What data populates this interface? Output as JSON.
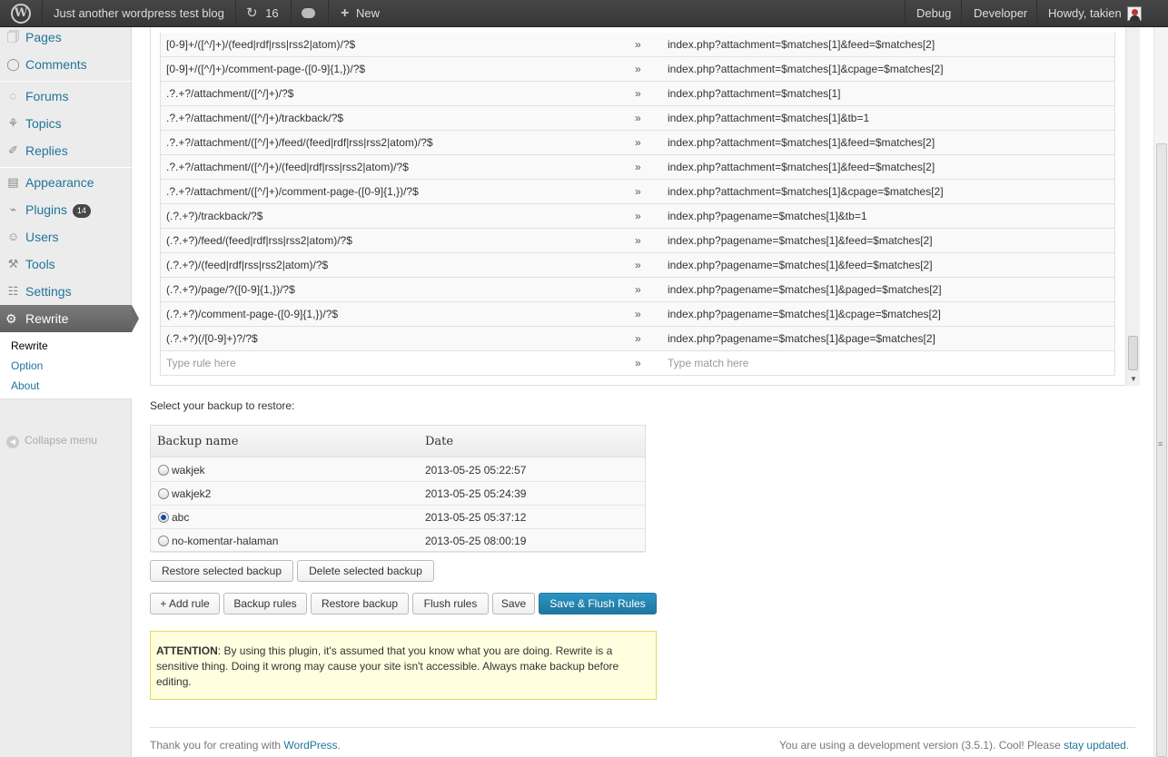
{
  "adminbar": {
    "site_name": "Just another wordpress test blog",
    "updates_count": "16",
    "new_label": "New",
    "debug_label": "Debug",
    "developer_label": "Developer",
    "greeting": "Howdy, takien"
  },
  "sidebar": {
    "items": [
      {
        "label": "Pages"
      },
      {
        "label": "Comments"
      },
      {
        "label": "Forums"
      },
      {
        "label": "Topics"
      },
      {
        "label": "Replies"
      },
      {
        "label": "Appearance"
      },
      {
        "label": "Plugins",
        "badge": "14"
      },
      {
        "label": "Users"
      },
      {
        "label": "Tools"
      },
      {
        "label": "Settings"
      },
      {
        "label": "Rewrite"
      }
    ],
    "submenu": [
      "Rewrite",
      "Option",
      "About"
    ],
    "collapse_label": "Collapse menu"
  },
  "rules": [
    {
      "pattern": "[0-9]+/([^/]+)/(feed|rdf|rss|rss2|atom)/?$",
      "match": "index.php?attachment=$matches[1]&feed=$matches[2]"
    },
    {
      "pattern": "[0-9]+/([^/]+)/comment-page-([0-9]{1,})/?$",
      "match": "index.php?attachment=$matches[1]&cpage=$matches[2]"
    },
    {
      "pattern": ".?.+?/attachment/([^/]+)/?$",
      "match": "index.php?attachment=$matches[1]"
    },
    {
      "pattern": ".?.+?/attachment/([^/]+)/trackback/?$",
      "match": "index.php?attachment=$matches[1]&tb=1"
    },
    {
      "pattern": ".?.+?/attachment/([^/]+)/feed/(feed|rdf|rss|rss2|atom)/?$",
      "match": "index.php?attachment=$matches[1]&feed=$matches[2]"
    },
    {
      "pattern": ".?.+?/attachment/([^/]+)/(feed|rdf|rss|rss2|atom)/?$",
      "match": "index.php?attachment=$matches[1]&feed=$matches[2]"
    },
    {
      "pattern": ".?.+?/attachment/([^/]+)/comment-page-([0-9]{1,})/?$",
      "match": "index.php?attachment=$matches[1]&cpage=$matches[2]"
    },
    {
      "pattern": "(.?.+?)/trackback/?$",
      "match": "index.php?pagename=$matches[1]&tb=1"
    },
    {
      "pattern": "(.?.+?)/feed/(feed|rdf|rss|rss2|atom)/?$",
      "match": "index.php?pagename=$matches[1]&feed=$matches[2]"
    },
    {
      "pattern": "(.?.+?)/(feed|rdf|rss|rss2|atom)/?$",
      "match": "index.php?pagename=$matches[1]&feed=$matches[2]"
    },
    {
      "pattern": "(.?.+?)/page/?([0-9]{1,})/?$",
      "match": "index.php?pagename=$matches[1]&paged=$matches[2]"
    },
    {
      "pattern": "(.?.+?)/comment-page-([0-9]{1,})/?$",
      "match": "index.php?pagename=$matches[1]&cpage=$matches[2]"
    },
    {
      "pattern": "(.?.+?)(/[0-9]+)?/?$",
      "match": "index.php?pagename=$matches[1]&page=$matches[2]"
    }
  ],
  "arrow": "»",
  "new_rule": {
    "pattern_placeholder": "Type rule here",
    "match_placeholder": "Type match here"
  },
  "backup": {
    "prompt": "Select your backup to restore:",
    "headers": {
      "name": "Backup name",
      "date": "Date"
    },
    "rows": [
      {
        "name": "wakjek",
        "date": "2013-05-25 05:22:57",
        "selected": false
      },
      {
        "name": "wakjek2",
        "date": "2013-05-25 05:24:39",
        "selected": false
      },
      {
        "name": "abc",
        "date": "2013-05-25 05:37:12",
        "selected": true
      },
      {
        "name": "no-komentar-halaman",
        "date": "2013-05-25 08:00:19",
        "selected": false
      }
    ],
    "restore_selected": "Restore selected backup",
    "delete_selected": "Delete selected backup"
  },
  "actions": {
    "add_rule": "+ Add rule",
    "backup_rules": "Backup rules",
    "restore_backup": "Restore backup",
    "flush_rules": "Flush rules",
    "save": "Save",
    "save_flush": "Save & Flush Rules"
  },
  "notice": {
    "strong": "ATTENTION",
    "text": ": By using this plugin, it's assumed that you know what you are doing. Rewrite is a sensitive thing. Doing it wrong may cause your site isn't accessible. Always make backup before editing."
  },
  "footer": {
    "left_text": "Thank you for creating with ",
    "left_link": "WordPress",
    "left_end": ".",
    "right_text": "You are using a development version (3.5.1). Cool! Please ",
    "right_link": "stay updated",
    "right_end": "."
  },
  "colors": {
    "link": "#21759b",
    "primary_button": "#21759b",
    "notice_bg": "#ffffe0",
    "adminbar_bg": "#464646"
  }
}
